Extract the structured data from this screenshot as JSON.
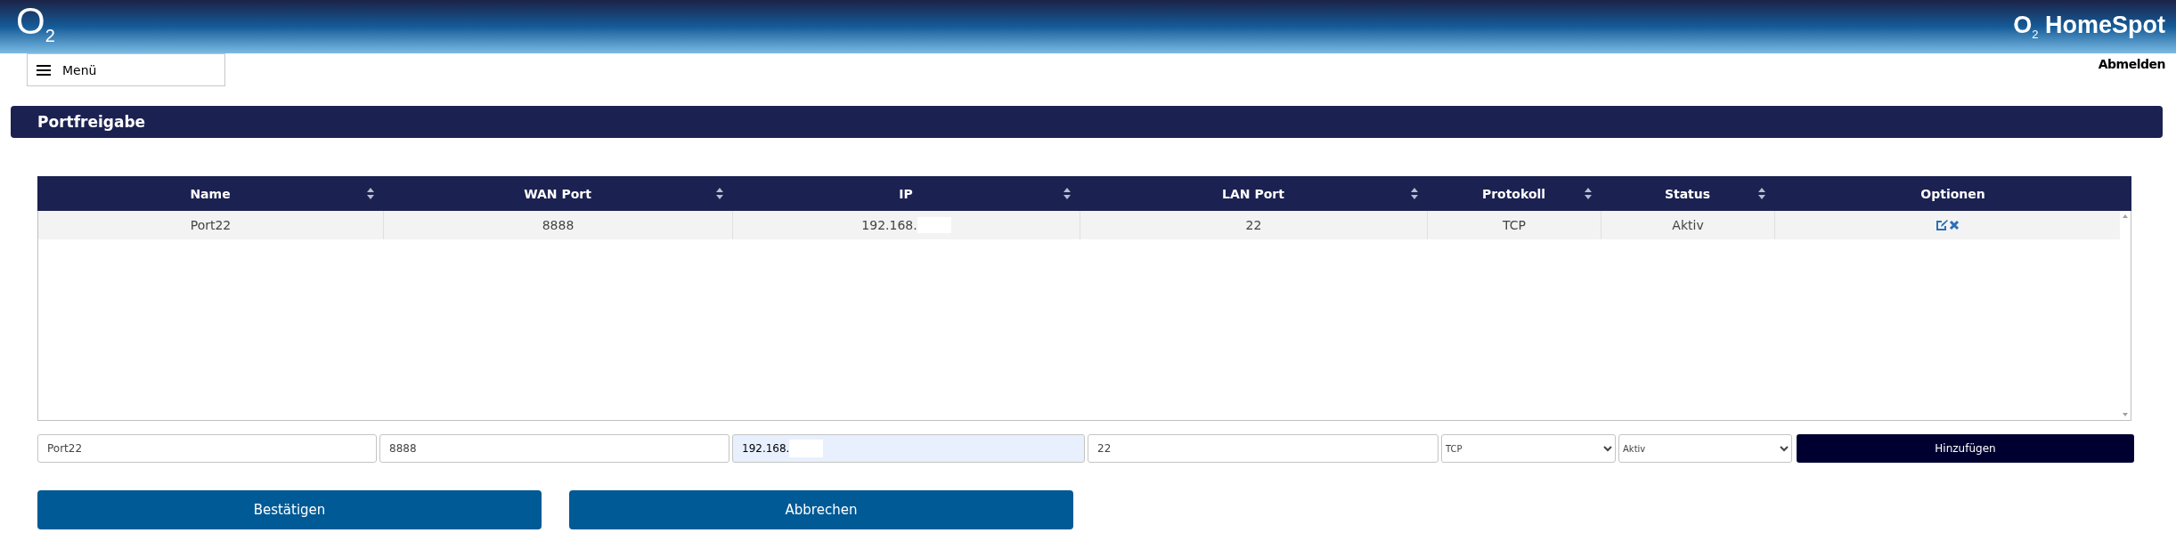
{
  "header": {
    "logo": "O",
    "logo_sub": "2",
    "brand_logo": "O",
    "brand_sub": "2",
    "brand": "HomeSpot"
  },
  "menu": {
    "label": "Menü"
  },
  "logout": "Abmelden",
  "section": {
    "title": "Portfreigabe"
  },
  "table": {
    "columns": [
      {
        "label": "Name",
        "sortable": true
      },
      {
        "label": "WAN Port",
        "sortable": true
      },
      {
        "label": "IP",
        "sortable": true
      },
      {
        "label": "LAN Port",
        "sortable": true
      },
      {
        "label": "Protokoll",
        "sortable": true
      },
      {
        "label": "Status",
        "sortable": true
      },
      {
        "label": "Optionen",
        "sortable": false
      }
    ],
    "rows": [
      {
        "name": "Port22",
        "wan_port": "8888",
        "ip": "192.168.",
        "lan_port": "22",
        "protocol": "TCP",
        "status": "Aktiv"
      }
    ]
  },
  "form": {
    "name": "Port22",
    "wan_port": "8888",
    "ip": "192.168.",
    "lan_port": "22",
    "protocol": "TCP",
    "status": "Aktiv",
    "add_button": "Hinzufügen"
  },
  "buttons": [
    "Bestätigen",
    "Abbrechen"
  ]
}
